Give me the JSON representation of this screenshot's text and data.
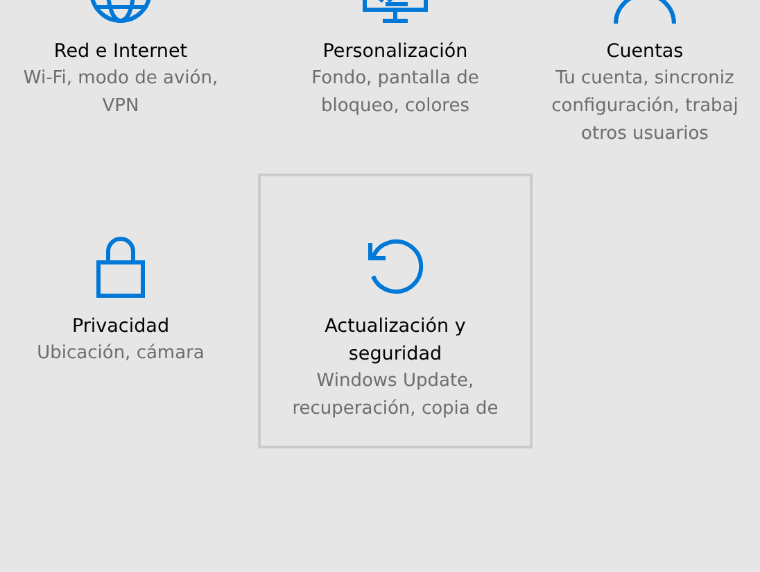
{
  "tiles": [
    {
      "title": [
        "Red e Internet"
      ],
      "description": [
        "Wi-Fi, modo de avión,",
        "VPN"
      ],
      "highlighted": false
    },
    {
      "title": [
        "Personalización"
      ],
      "description": [
        "Fondo, pantalla de",
        "bloqueo, colores"
      ],
      "highlighted": false
    },
    {
      "title": [
        "Cuentas"
      ],
      "description": [
        "Tu cuenta, sincroniz",
        "configuración, trabaj",
        "otros usuarios"
      ],
      "highlighted": false
    },
    {
      "title": [
        "Privacidad"
      ],
      "description": [
        "Ubicación, cámara"
      ],
      "highlighted": false
    },
    {
      "title": [
        "Actualización y",
        "seguridad"
      ],
      "description": [
        "Windows Update,",
        "recuperación, copia de"
      ],
      "highlighted": true
    }
  ]
}
